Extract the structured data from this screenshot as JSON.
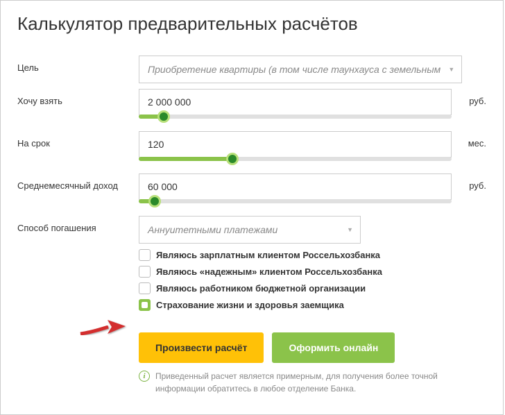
{
  "title": "Калькулятор предварительных расчётов",
  "fields": {
    "purpose": {
      "label": "Цель",
      "selected": "Приобретение квартиры (в том числе таунхауса с земельным"
    },
    "amount": {
      "label": "Хочу взять",
      "value": "2 000 000",
      "unit": "руб.",
      "slider_pct": 8
    },
    "term": {
      "label": "На срок",
      "value": "120",
      "unit": "мес.",
      "slider_pct": 30
    },
    "income": {
      "label": "Среднемесячный доход",
      "value": "60 000",
      "unit": "руб.",
      "slider_pct": 5
    },
    "repayment": {
      "label": "Способ погашения",
      "selected": "Аннуитетными платежами"
    }
  },
  "checkboxes": [
    {
      "label": "Являюсь зарплатным клиентом Россельхозбанка",
      "checked": false
    },
    {
      "label": "Являюсь «надежным» клиентом Россельхозбанка",
      "checked": false
    },
    {
      "label": "Являюсь работником бюджетной организации",
      "checked": false
    },
    {
      "label": "Страхование жизни и здоровья заемщика",
      "checked": true
    }
  ],
  "buttons": {
    "calculate": "Произвести расчёт",
    "apply": "Оформить онлайн"
  },
  "note": "Приведенный расчет является примерным, для получения более точной информации обратитесь в любое отделение Банка."
}
